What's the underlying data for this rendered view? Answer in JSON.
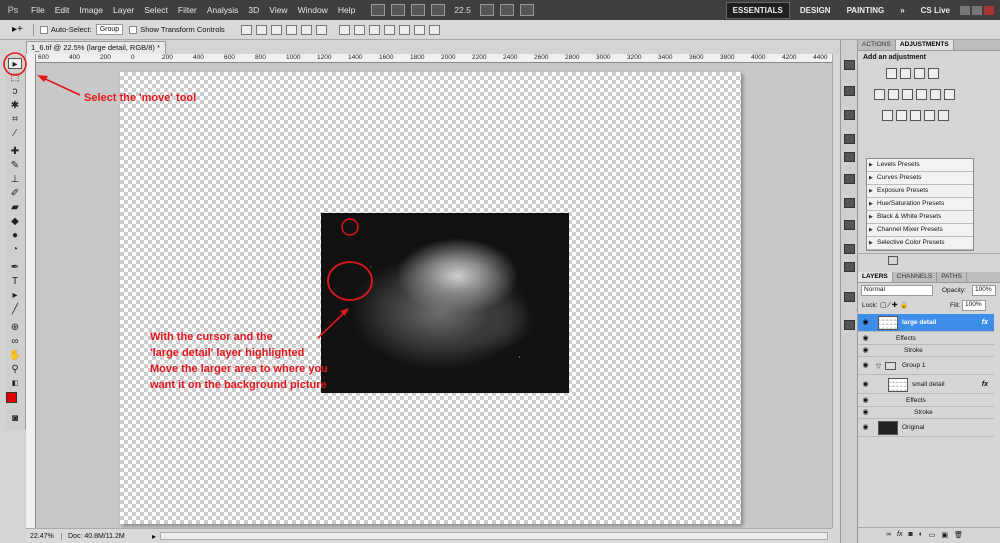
{
  "app": {
    "logo": "Ps",
    "menu": [
      "File",
      "Edit",
      "Image",
      "Layer",
      "Select",
      "Filter",
      "Analysis",
      "3D",
      "View",
      "Window",
      "Help"
    ],
    "zoom": "22.5",
    "workspaces": [
      "ESSENTIALS",
      "DESIGN",
      "PAINTING"
    ],
    "more": "»",
    "cs_live": "CS Live"
  },
  "options": {
    "auto_select_label": "Auto-Select:",
    "auto_select_value": "Group",
    "show_transform_label": "Show Transform Controls"
  },
  "document": {
    "tab_title": "1_6.tif @ 22.5% (large detail, RGB/8) *",
    "ruler_ticks": [
      "600",
      "400",
      "200",
      "0",
      "200",
      "400",
      "600",
      "800",
      "1000",
      "1200",
      "1400",
      "1600",
      "1800",
      "2000",
      "2200",
      "2400",
      "2600",
      "2800",
      "3000",
      "3200",
      "3400",
      "3600",
      "3800",
      "4000",
      "4200",
      "4400"
    ]
  },
  "status": {
    "zoom": "22.47%",
    "doc": "Doc: 40.8M/11.2M"
  },
  "adjustments": {
    "tabs": [
      "ACTIONS",
      "ADJUSTMENTS"
    ],
    "title": "Add an adjustment",
    "presets": [
      "Levels Presets",
      "Curves Presets",
      "Exposure Presets",
      "Hue/Saturation Presets",
      "Black & White Presets",
      "Channel Mixer Presets",
      "Selective Color Presets"
    ]
  },
  "layers": {
    "tabs": [
      "LAYERS",
      "CHANNELS",
      "PATHS"
    ],
    "blend_mode": "Normal",
    "opacity_label": "Opacity:",
    "opacity_value": "100%",
    "lock_label": "Lock:",
    "fill_label": "Fill:",
    "fill_value": "100%",
    "rows": [
      {
        "name": "large detail",
        "fx": "fx"
      },
      {
        "name": "Effects"
      },
      {
        "name": "Stroke"
      },
      {
        "name": "Group 1"
      },
      {
        "name": "small detail",
        "fx": "fx"
      },
      {
        "name": "Effects"
      },
      {
        "name": "Stroke"
      },
      {
        "name": "Original"
      }
    ]
  },
  "annotations": {
    "move_tool": "Select the 'move' tool",
    "instructions": [
      "With the cursor and the",
      "'large detail' layer highlighted",
      "Move the larger area to where you",
      "want it on the background picture"
    ]
  },
  "colors": {
    "annotation_red": "#e3161c",
    "foreground_swatch": "#e00000",
    "layer_highlight": "#3d8ee8"
  }
}
